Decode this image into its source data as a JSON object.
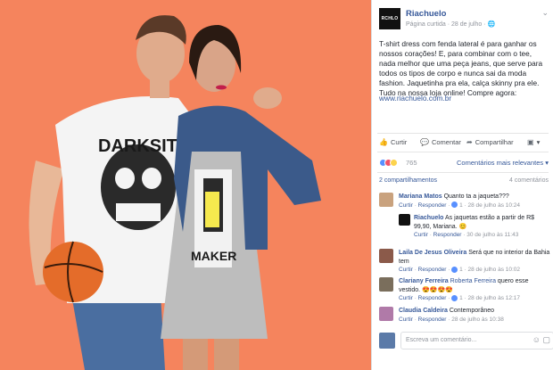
{
  "post": {
    "page_name": "Riachuelo",
    "logo_text": "RCHLO",
    "meta": "Página curtida · 28 de julho · ",
    "text": "T-shirt dress com fenda lateral é para ganhar os nossos corações! E, para combinar com o tee, nada melhor que uma peça jeans, que serve para todos os tipos de corpo e nunca sai da moda fashion. Jaquetinha pra ela, calça skinny pra ele. Tudo na nossa loja online! Compre agora:",
    "link": "www.riachuelo.com.br"
  },
  "actions": {
    "like": "Curtir",
    "comment": "Comentar",
    "share": "Compartilhar"
  },
  "reactions": {
    "count": "765",
    "sort_label": "Comentários mais relevantes ▾",
    "colors": [
      "#5890ff",
      "#f25268",
      "#fcd34d"
    ]
  },
  "shares": {
    "label": "2 compartilhamentos",
    "comments_count": "4 comentários"
  },
  "comments": [
    {
      "author": "Mariana Matos",
      "text": "Quanto ta a jaqueta???",
      "meta_like": "Curtir",
      "meta_reply": "Responder",
      "likes": "1",
      "time": "28 de julho às 10:24",
      "avatar_color": "#c9a27e"
    },
    {
      "author": "Riachuelo",
      "text": "As jaquetas estão a partir de R$ 99,90, Mariana. 😊",
      "meta_like": "Curtir",
      "meta_reply": "Responder",
      "likes": "",
      "time": "30 de julho às 11:43",
      "avatar_color": "#111111",
      "is_reply": true
    },
    {
      "author": "Laila De Jesus Oliveira",
      "text": "Será que no interior da Bahia tem",
      "meta_like": "Curtir",
      "meta_reply": "Responder",
      "likes": "1",
      "time": "28 de julho às 10:02",
      "avatar_color": "#8b5a4a"
    },
    {
      "author": "Clariany Ferreira",
      "tag": "Roberta Ferreira",
      "text": "quero esse vestido. 😍😍😍😍",
      "meta_like": "Curtir",
      "meta_reply": "Responder",
      "likes": "1",
      "time": "28 de julho às 12:17",
      "avatar_color": "#7a6e5c"
    },
    {
      "author": "Claudia Caldeira",
      "text": "Contemporâneo",
      "meta_like": "Curtir",
      "meta_reply": "Responder",
      "likes": "",
      "time": "28 de julho às 10:38",
      "avatar_color": "#b07aa8"
    }
  ],
  "write": {
    "placeholder": "Escreva um comentário..."
  },
  "photo": {
    "background": "#f5845d",
    "shirt_text_1": "DARKSIT",
    "shirt_text_2": "MAKER"
  }
}
